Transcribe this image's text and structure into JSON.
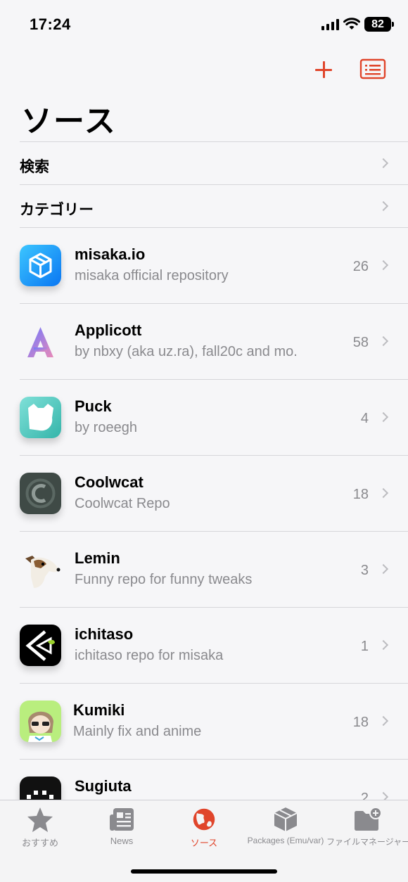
{
  "status_bar": {
    "time": "17:24",
    "battery": "82"
  },
  "nav": {
    "title": "ソース",
    "add_icon": "plus-icon",
    "list_icon": "list-card-icon"
  },
  "menu_rows": [
    {
      "label": "検索"
    },
    {
      "label": "カテゴリー"
    }
  ],
  "sources": [
    {
      "name": "misaka.io",
      "description": "misaka official repository",
      "count": "26",
      "icon": "box-icon"
    },
    {
      "name": "Applicott",
      "description": "by nbxy (aka uz.ra), fall20c and mo.",
      "count": "58",
      "icon": "applicott-logo"
    },
    {
      "name": "Puck",
      "description": "by roeegh",
      "count": "4",
      "icon": "puck-logo"
    },
    {
      "name": "Coolwcat",
      "description": "Coolwcat Repo",
      "count": "18",
      "icon": "coolwcat-logo"
    },
    {
      "name": "Lemin",
      "description": "Funny repo for funny tweaks",
      "count": "3",
      "icon": "dog-avatar"
    },
    {
      "name": "ichitaso",
      "description": "ichitaso repo for misaka",
      "count": "1",
      "icon": "ichitaso-logo"
    },
    {
      "name": "Kumiki",
      "description": "Mainly fix and anime",
      "count": "18",
      "icon": "anime-avatar"
    },
    {
      "name": "Sugiuta",
      "description": "",
      "count": "2",
      "icon": "sugiuta-logo"
    }
  ],
  "tabs": [
    {
      "label": "おすすめ",
      "icon": "star-icon"
    },
    {
      "label": "News",
      "icon": "newspaper-icon"
    },
    {
      "label": "ソース",
      "icon": "globe-icon",
      "active": true
    },
    {
      "label": "Packages (Emu/var)",
      "icon": "package-icon"
    },
    {
      "label": "ファイルマネージャー",
      "icon": "folder-add-icon"
    }
  ],
  "colors": {
    "accent": "#e0452b",
    "secondary_text": "#8a8a8e"
  }
}
